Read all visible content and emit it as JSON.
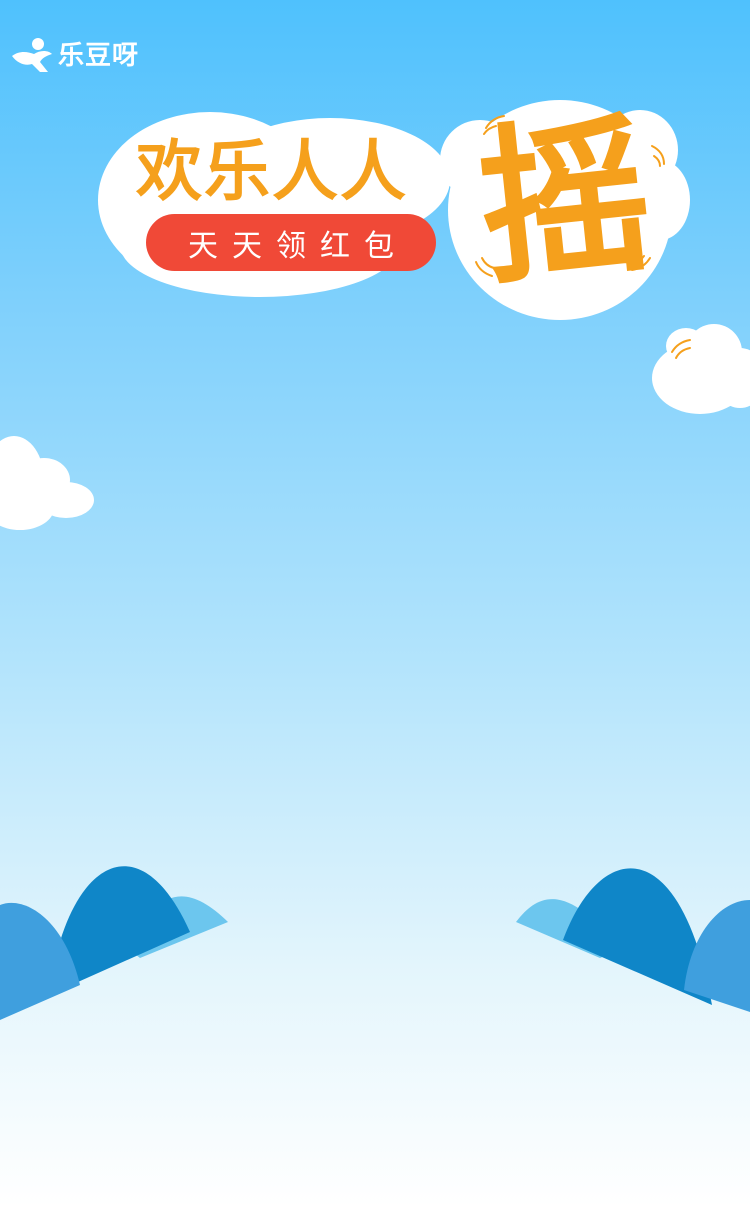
{
  "brand": {
    "name": "乐豆呀",
    "icon": "person-waving-icon"
  },
  "banner": {
    "title": "欢乐人人",
    "subtitle": "天天领红包",
    "shake_char": "摇"
  },
  "colors": {
    "sky_top": "#4fc1fd",
    "sky_bottom": "#ffffff",
    "title_orange": "#f5a01c",
    "pill_red": "#f04937",
    "mountain_dark": "#0f86c8",
    "mountain_mid": "#3f9fde",
    "mountain_light": "#6cc6ee"
  }
}
